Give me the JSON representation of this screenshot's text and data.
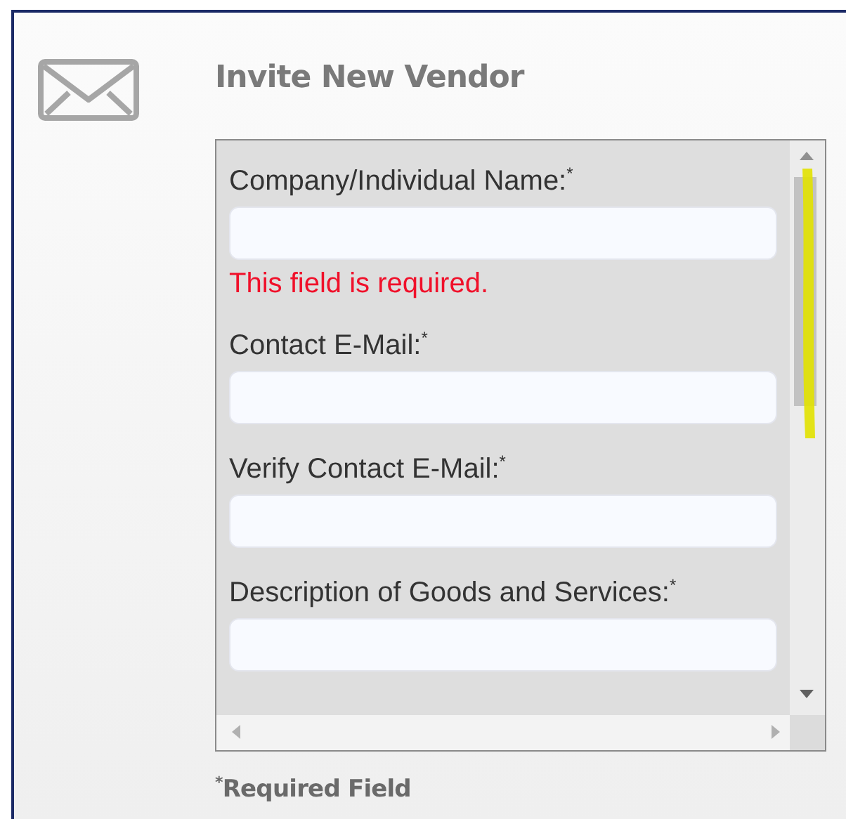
{
  "dialog": {
    "title": "Invite New Vendor",
    "fields": [
      {
        "label": "Company/Individual Name:$^{*}$",
        "error": "This field is required."
      },
      {
        "label": "Contact E-Mail:$^{*}$"
      },
      {
        "label": "Verify Contact E-Mail:$^{*}$"
      },
      {
        "label": "Description of Goods and Services:$^{*}$"
      }
    ],
    "footnote": "$^{*}$Required Field"
  }
}
